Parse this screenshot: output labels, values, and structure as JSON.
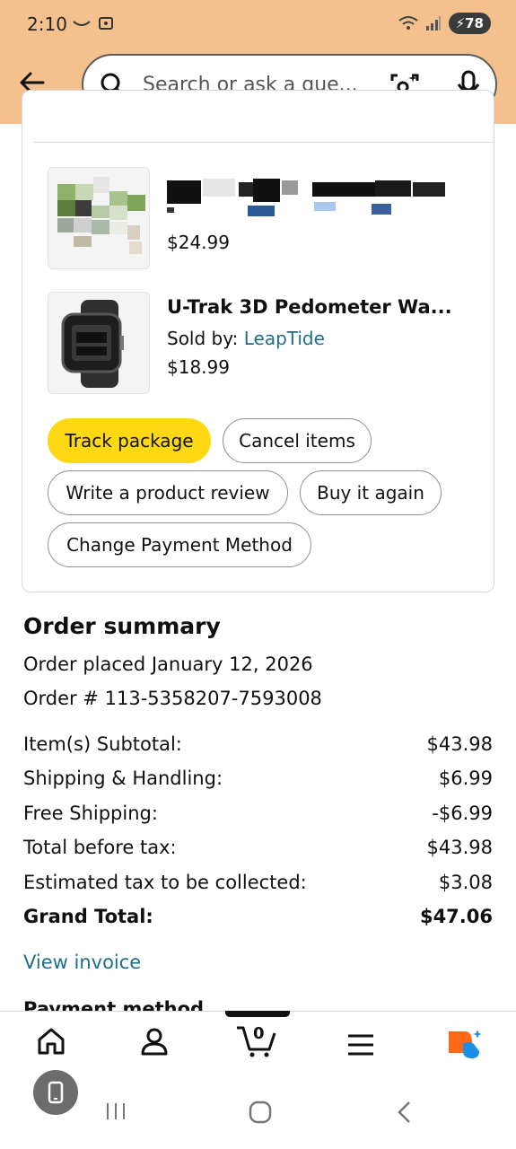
{
  "status_bar": {
    "time": "2:10",
    "battery": "78"
  },
  "search": {
    "placeholder": "Search or ask a que..."
  },
  "items": [
    {
      "price": "$24.99"
    },
    {
      "title": "U-Trak 3D Pedometer Wa...",
      "sold_by_label": "Sold by:",
      "seller": "LeapTide",
      "price": "$18.99"
    }
  ],
  "actions": {
    "track": "Track package",
    "cancel": "Cancel items",
    "review": "Write a product review",
    "buy_again": "Buy it again",
    "change_payment": "Change Payment Method"
  },
  "order_summary": {
    "title": "Order summary",
    "placed": "Order placed January 12, 2026",
    "order_number": "Order # 113-5358207-7593008",
    "rows": [
      {
        "label": "Item(s) Subtotal:",
        "value": "$43.98"
      },
      {
        "label": "Shipping & Handling:",
        "value": "$6.99"
      },
      {
        "label": "Free Shipping:",
        "value": "-$6.99"
      },
      {
        "label": "Total before tax:",
        "value": "$43.98"
      },
      {
        "label": "Estimated tax to be collected:",
        "value": "$3.08"
      },
      {
        "label": "Grand Total:",
        "value": "$47.06"
      }
    ],
    "view_invoice": "View invoice",
    "next_section_partial": "Payment method"
  },
  "nav": {
    "cart_count": "0"
  },
  "icons": {
    "back": "arrow-left-icon",
    "search": "search-icon",
    "lens": "camera-lens-icon",
    "mic": "microphone-icon",
    "home": "home-icon",
    "account": "person-icon",
    "cart": "cart-icon",
    "menu": "hamburger-icon",
    "rufus": "assistant-icon"
  },
  "colors": {
    "header": "#f3c08e",
    "track_button": "#ffd814",
    "link": "#1f6e8c",
    "rufus_orange": "#ff6a1a",
    "rufus_blue": "#1a8fe3"
  }
}
